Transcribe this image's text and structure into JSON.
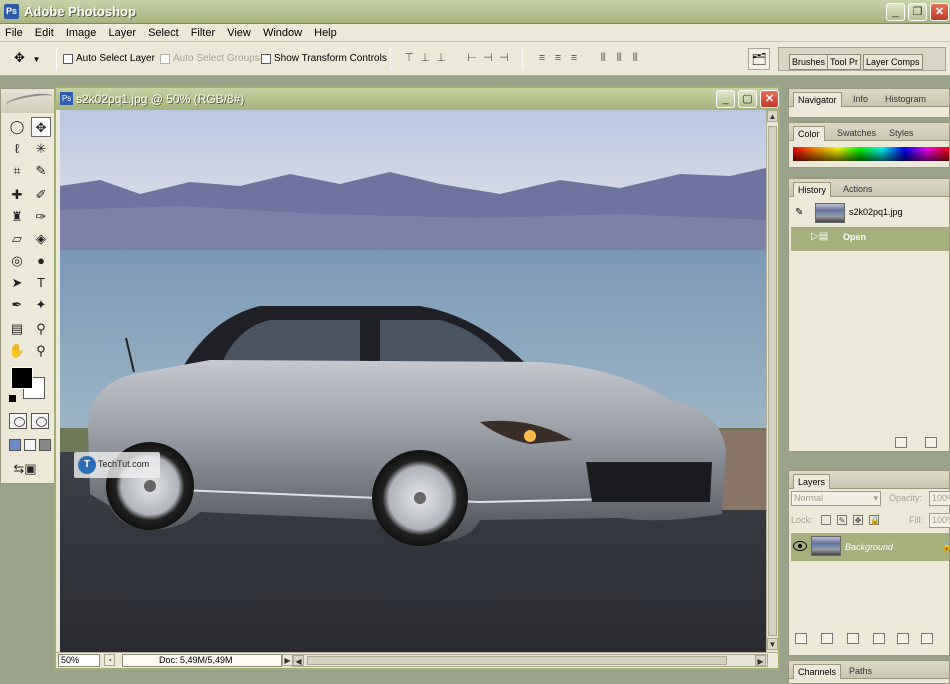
{
  "app": {
    "title": "Adobe Photoshop"
  },
  "menu": [
    "File",
    "Edit",
    "Image",
    "Layer",
    "Select",
    "Filter",
    "View",
    "Window",
    "Help"
  ],
  "options": {
    "auto_select_layer": "Auto Select Layer",
    "auto_select_groups": "Auto Select Groups",
    "show_transform_controls": "Show Transform Controls"
  },
  "palette_well": {
    "tabs": [
      "Brushes",
      "Tool Pr",
      "Layer Comps"
    ]
  },
  "document": {
    "title": "s2k02pq1.jpg @ 50% (RGB/8#)",
    "zoom": "50%",
    "doc_size": "Doc: 5,49M/5,49M"
  },
  "watermark": {
    "text": "TechTut.com",
    "logo_letter": "T"
  },
  "navigator_palette": {
    "tabs": [
      "Navigator",
      "Info",
      "Histogram"
    ]
  },
  "color_palette": {
    "tabs": [
      "Color",
      "Swatches",
      "Styles"
    ]
  },
  "history_palette": {
    "tabs": [
      "History",
      "Actions"
    ],
    "snapshot": "s2k02pq1.jpg",
    "steps": [
      "Open"
    ]
  },
  "layers_palette": {
    "title": "Layers",
    "blend_mode": "Normal",
    "opacity_label": "Opacity:",
    "opacity_value": "100%",
    "lock_label": "Lock:",
    "fill_label": "Fill:",
    "fill_value": "100%",
    "layers": [
      {
        "name": "Background"
      }
    ]
  },
  "channels_palette": {
    "tabs": [
      "Channels",
      "Paths"
    ]
  },
  "colors": {
    "chrome_accent": "#a5b27a",
    "foreground": "#000000",
    "background": "#ffffff"
  }
}
